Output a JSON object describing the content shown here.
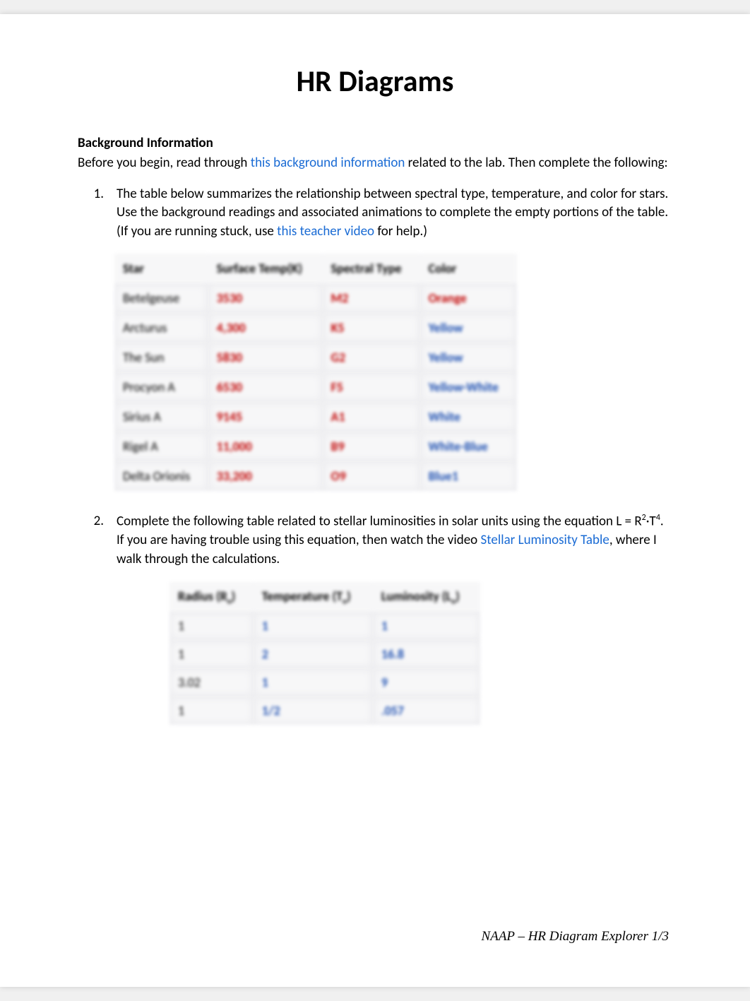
{
  "title": "HR Diagrams",
  "section_heading": "Background Information",
  "intro": {
    "before_link": "Before you begin, read through ",
    "link": "this background information",
    "after_link": " related to the lab. Then complete the following:"
  },
  "q1": {
    "num": "1.",
    "text_before": "The table below summarizes the relationship between spectral type, temperature, and color for stars.  Use the background readings and associated animations to complete the empty portions of the table. (If you are running stuck, use ",
    "link": "this teacher video",
    "text_after": " for help.)"
  },
  "table1": {
    "headers": [
      "Star",
      "Surface Temp(K)",
      "Spectral Type",
      "Color"
    ],
    "rows": [
      {
        "star": "Betelgeuse",
        "temp": "3530",
        "spec": "M2",
        "color": "Orange",
        "temp_cls": "fill-red",
        "spec_cls": "fill-red",
        "color_cls": "fill-red"
      },
      {
        "star": "Arcturus",
        "temp": "4,300",
        "spec": "K5",
        "color": "Yellow",
        "temp_cls": "fill-red",
        "spec_cls": "fill-red",
        "color_cls": "fill-blue"
      },
      {
        "star": "The Sun",
        "temp": "5830",
        "spec": "G2",
        "color": "Yellow",
        "temp_cls": "fill-red",
        "spec_cls": "fill-red",
        "color_cls": "fill-blue"
      },
      {
        "star": "Procyon A",
        "temp": "6530",
        "spec": "F5",
        "color": "Yellow-White",
        "temp_cls": "fill-red",
        "spec_cls": "fill-red",
        "color_cls": "fill-blue"
      },
      {
        "star": "Sirius A",
        "temp": "9145",
        "spec": "A1",
        "color": "White",
        "temp_cls": "fill-red",
        "spec_cls": "fill-red",
        "color_cls": "fill-blue"
      },
      {
        "star": "Rigel A",
        "temp": "11,000",
        "spec": "B9",
        "color": "White-Blue",
        "temp_cls": "fill-red",
        "spec_cls": "fill-red",
        "color_cls": "fill-blue"
      },
      {
        "star": "Delta Orionis",
        "temp": "33,200",
        "spec": "O9",
        "color": "Blue1",
        "temp_cls": "fill-red",
        "spec_cls": "fill-red",
        "color_cls": "fill-blue"
      }
    ]
  },
  "q2": {
    "num": "2.",
    "text_before": "Complete the following table related to stellar luminosities in solar units using the equation L = R",
    "sup1": "2",
    "mid": "·T",
    "sup2": "4",
    "after_eq": ". If you are having trouble using this equation, then watch the video ",
    "link": "Stellar Luminosity Table",
    "text_after": ", where I walk through the calculations."
  },
  "table2": {
    "h1": "Radius (R",
    "h1sub": "o",
    "h1end": ")",
    "h2": "Temperature (T",
    "h2sub": "o",
    "h2end": ")",
    "h3": "Luminosity (L",
    "h3sub": "o",
    "h3end": ")",
    "rows": [
      {
        "r": "1",
        "t": "1",
        "l": "1",
        "r_cls": "black-cell",
        "t_cls": "fill-blue",
        "l_cls": "fill-blue"
      },
      {
        "r": "1",
        "t": "2",
        "l": "16.8",
        "r_cls": "black-cell",
        "t_cls": "fill-blue",
        "l_cls": "fill-blue"
      },
      {
        "r": "3.02",
        "t": "1",
        "l": "9",
        "r_cls": "black-cell",
        "t_cls": "fill-blue",
        "l_cls": "fill-blue"
      },
      {
        "r": "1",
        "t": "1/2",
        "l": ".057",
        "r_cls": "black-cell",
        "t_cls": "fill-blue",
        "l_cls": "fill-blue"
      }
    ]
  },
  "footer": "NAAP – HR Diagram Explorer 1/3"
}
